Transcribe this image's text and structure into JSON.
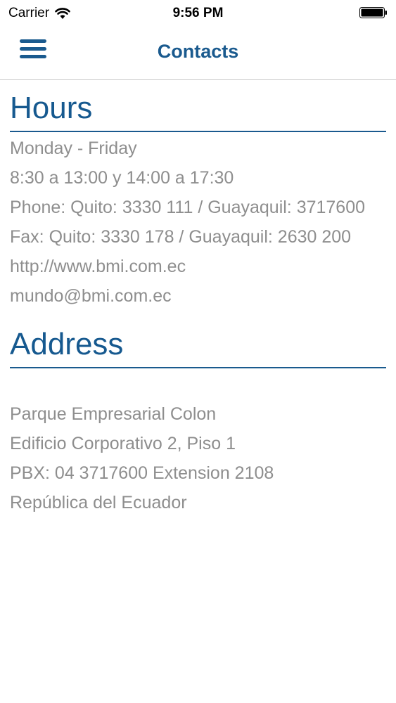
{
  "status_bar": {
    "carrier": "Carrier",
    "time": "9:56 PM"
  },
  "nav": {
    "title": "Contacts",
    "menu_icon": "hamburger-menu-icon"
  },
  "colors": {
    "accent": "#1a5a8e",
    "text_secondary": "#8e8e8e"
  },
  "hours": {
    "title": "Hours",
    "lines": [
      "Monday - Friday",
      "8:30 a 13:00 y 14:00 a 17:30",
      "Phone: Quito: 3330 111 / Guayaquil: 3717600",
      "Fax: Quito: 3330 178 / Guayaquil: 2630 200",
      "http://www.bmi.com.ec",
      "mundo@bmi.com.ec"
    ]
  },
  "address": {
    "title": "Address",
    "lines": [
      "Parque Empresarial Colon",
      "Edificio Corporativo 2, Piso 1",
      "PBX: 04 3717600 Extension 2108",
      "República del Ecuador"
    ]
  }
}
